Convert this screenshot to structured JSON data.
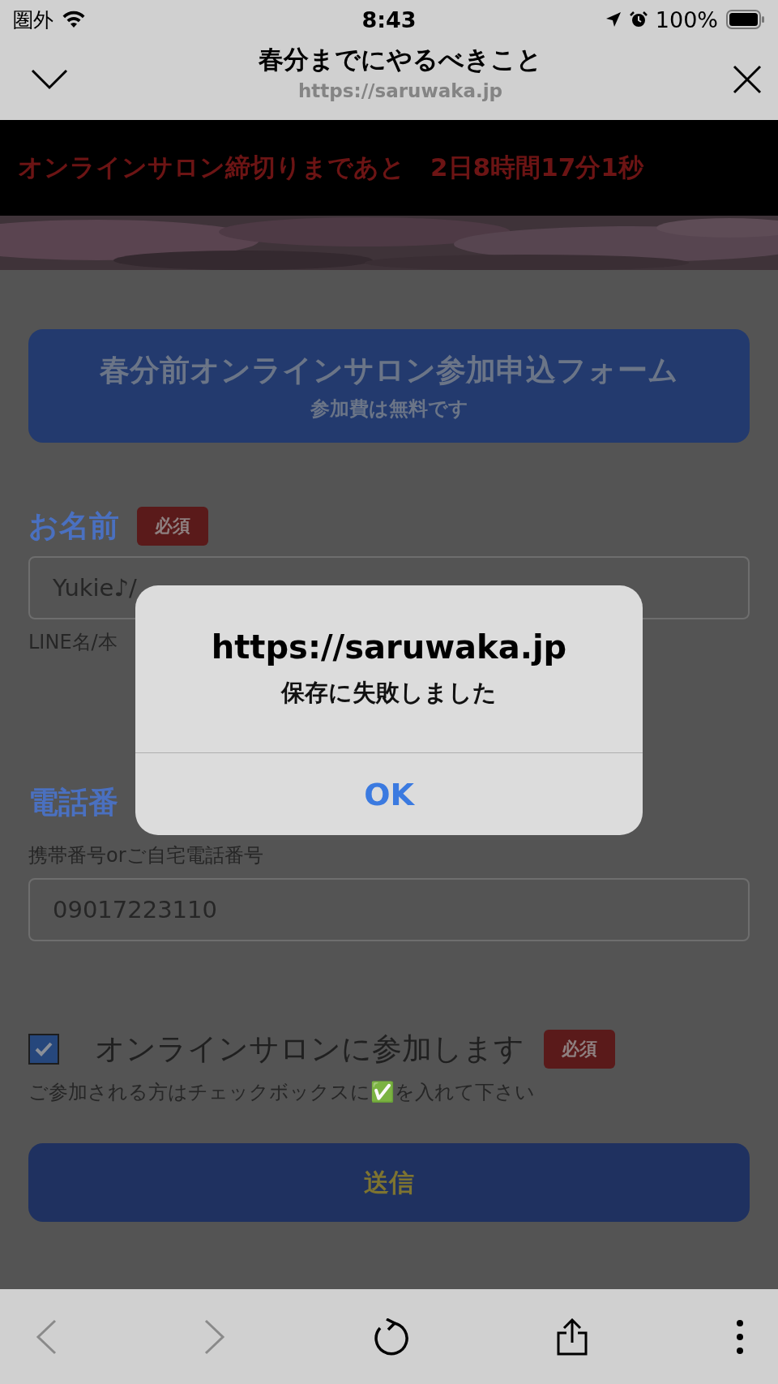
{
  "status_bar": {
    "carrier": "圏外",
    "time": "8:43",
    "battery": "100%"
  },
  "browser": {
    "title": "春分までにやるべきこと",
    "url": "https://saruwaka.jp"
  },
  "countdown": "オンラインサロン締切りまであと　2日8時間17分1秒",
  "form": {
    "title": "春分前オンラインサロン参加申込フォーム",
    "subtitle": "参加費は無料です",
    "fields": [
      {
        "kind": "note-below",
        "label": "お名前",
        "badge": "必須",
        "value": "Yukie♪/",
        "note": "LINE名/本"
      },
      {
        "kind": "note-above",
        "label": "電話番",
        "note": "携帯番号orご自宅電話番号",
        "value": "09017223110"
      }
    ],
    "agree": {
      "label": "オンラインサロンに参加します",
      "checked": true,
      "badge": "必須",
      "note": "ご参加される方はチェックボックスに✅を入れて下さい"
    },
    "submit": "送信"
  },
  "dialog": {
    "title": "https://saruwaka.jp",
    "message": "保存に失敗しました",
    "button": "OK"
  }
}
